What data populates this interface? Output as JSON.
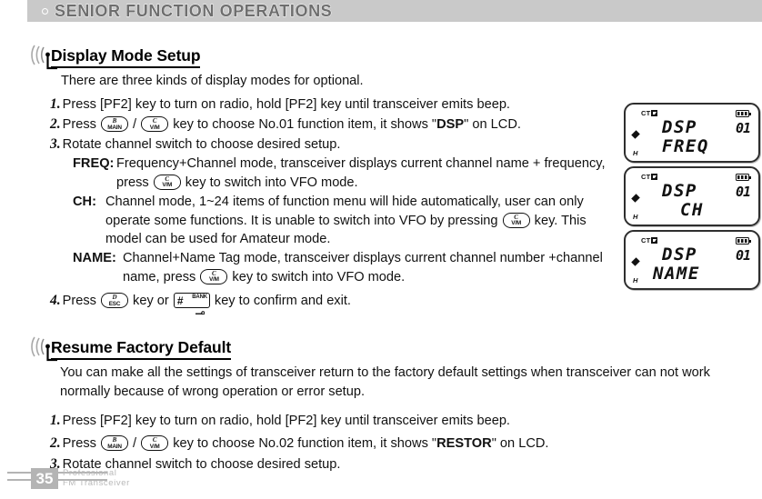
{
  "header": {
    "title": "SENIOR FUNCTION OPERATIONS",
    "bullet_icon": "circle-outline-icon",
    "band_color": "#c9c9c9",
    "text_color": "#6e6e6e"
  },
  "sections": [
    {
      "id": "display-mode-setup",
      "icon": "radio-wave-icon",
      "title": "Display Mode Setup",
      "intro": "There are three kinds of display modes for optional.",
      "steps": [
        {
          "num": "1.",
          "parts": [
            {
              "t": "Press [PF2] key to turn on radio, hold [PF2] key until transceiver emits beep."
            }
          ]
        },
        {
          "num": "2.",
          "parts": [
            {
              "t": "Press "
            },
            {
              "key": {
                "top": "B",
                "bottom": "MAIN"
              }
            },
            {
              "t": " / "
            },
            {
              "key": {
                "top": "C",
                "bottom": "V/M"
              }
            },
            {
              "t": " key to choose No.01 function item, it shows \""
            },
            {
              "t": "DSP",
              "bold": true
            },
            {
              "t": "\" on LCD."
            }
          ]
        },
        {
          "num": "3.",
          "parts": [
            {
              "t": "Rotate channel switch to choose desired setup."
            }
          ]
        }
      ],
      "definitions": [
        {
          "term": "FREQ:",
          "parts": [
            {
              "t": " Frequency+Channel mode, transceiver displays current channel name + frequency, press "
            },
            {
              "key": {
                "top": "C",
                "bottom": "V/M"
              }
            },
            {
              "t": " key to switch into VFO mode."
            }
          ]
        },
        {
          "term": "CH:",
          "parts": [
            {
              "t": " Channel mode, 1~24 items of function menu will hide automatically, user can only operate some functions. It is unable to switch into VFO by pressing "
            },
            {
              "key": {
                "top": "C",
                "bottom": "V/M"
              }
            },
            {
              "t": " key. This model can be used for Amateur mode."
            }
          ]
        },
        {
          "term": "NAME:",
          "parts": [
            {
              "t": " Channel+Name Tag mode, transceiver displays current channel number +channel name, press "
            },
            {
              "key": {
                "top": "C",
                "bottom": "V/M"
              }
            },
            {
              "t": " key to switch into VFO mode."
            }
          ]
        }
      ],
      "final_step": {
        "num": "4.",
        "parts": [
          {
            "t": "Press "
          },
          {
            "key": {
              "top": "D",
              "bottom": "ESC"
            }
          },
          {
            "t": " key or "
          },
          {
            "key_sq": {
              "hash": "#",
              "bank": "BANK",
              "lock_icon": "lock-icon"
            }
          },
          {
            "t": " key to confirm and exit."
          }
        ]
      }
    },
    {
      "id": "resume-factory-default",
      "icon": "radio-wave-icon",
      "title": "Resume Factory Default",
      "paragraph": "You can make all the settings of transceiver return to the factory default settings when transceiver can not work normally because of wrong operation or error setup.",
      "steps": [
        {
          "num": "1.",
          "parts": [
            {
              "t": "Press [PF2] key to turn on radio, hold [PF2] key until transceiver emits beep."
            }
          ]
        },
        {
          "num": "2.",
          "parts": [
            {
              "t": "Press "
            },
            {
              "key": {
                "top": "B",
                "bottom": "MAIN"
              }
            },
            {
              "t": " / "
            },
            {
              "key": {
                "top": "C",
                "bottom": "V/M"
              }
            },
            {
              "t": " key to choose No.02 function item, it shows \""
            },
            {
              "t": "RESTOR",
              "bold": true
            },
            {
              "t": "\" on LCD."
            }
          ]
        },
        {
          "num": "3.",
          "parts": [
            {
              "t": "Rotate channel switch to choose desired setup."
            }
          ]
        }
      ]
    }
  ],
  "lcd_panels": [
    {
      "ct": "CT",
      "ct_icon": "ct-indicator-icon",
      "battery_icon": "battery-icon",
      "number": "01",
      "line1": "DSP",
      "line2": "FREQ",
      "diamond_icon": "diamond-indicator-icon",
      "h": "H"
    },
    {
      "ct": "CT",
      "ct_icon": "ct-indicator-icon",
      "battery_icon": "battery-icon",
      "number": "01",
      "line1": "DSP",
      "line2": "CH",
      "diamond_icon": "diamond-indicator-icon",
      "h": "H"
    },
    {
      "ct": "CT",
      "ct_icon": "ct-indicator-icon",
      "battery_icon": "battery-icon",
      "number": "01",
      "line1": "DSP",
      "line2": "NAME",
      "diamond_icon": "diamond-indicator-icon",
      "h": "H"
    }
  ],
  "footer": {
    "page_number": "35",
    "brand_line1": "Professional",
    "brand_line2": "FM Transceiver",
    "accent_color": "#b4b4b4"
  }
}
